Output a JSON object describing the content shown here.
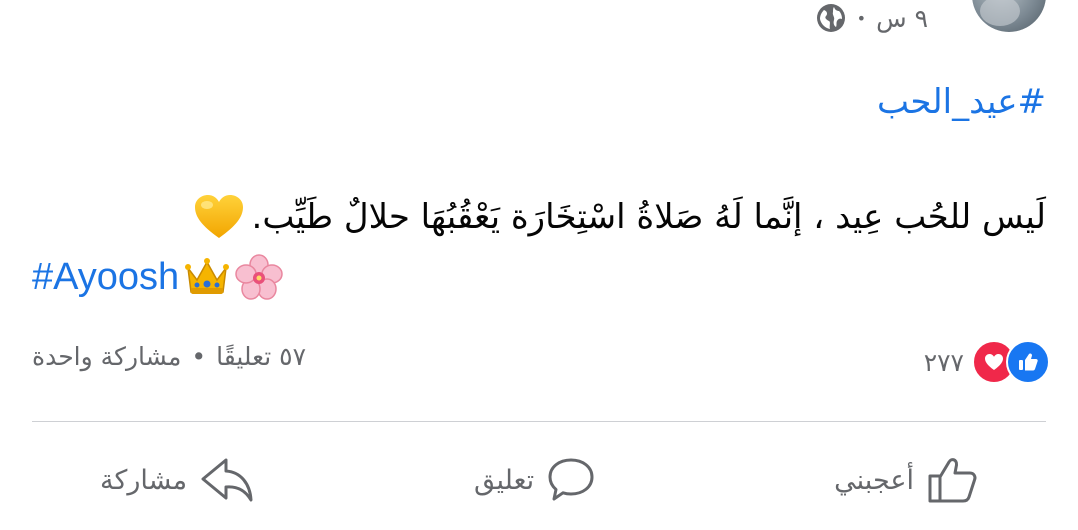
{
  "header": {
    "time": "٩ س",
    "separator": "•",
    "privacy_icon": "globe-icon"
  },
  "post": {
    "hashtag": "#عيد_الحب",
    "text": "لَيس للحُب عِيد ، إنَّما لَهُ صَلاةُ اسْتِخَارَة يَعْقُبُهَا حلالٌ طَيِّب.",
    "text_emoji": "yellow-heart-icon",
    "tag": "#Ayoosh",
    "tag_emojis": [
      "crown-icon",
      "cherry-blossom-icon"
    ]
  },
  "stats": {
    "reaction_count": "٢٧٧",
    "reaction_icons": [
      "like-reaction-icon",
      "love-reaction-icon"
    ],
    "comments": "٥٧ تعليقًا",
    "separator": "•",
    "shares": "مشاركة واحدة"
  },
  "actions": {
    "like": "أعجبني",
    "comment": "تعليق",
    "share": "مشاركة"
  },
  "colors": {
    "link": "#1b74e4",
    "secondary_text": "#65676b",
    "like_blue": "#1877f2",
    "love_red": "#f0284a",
    "divider": "#ced0d4"
  }
}
